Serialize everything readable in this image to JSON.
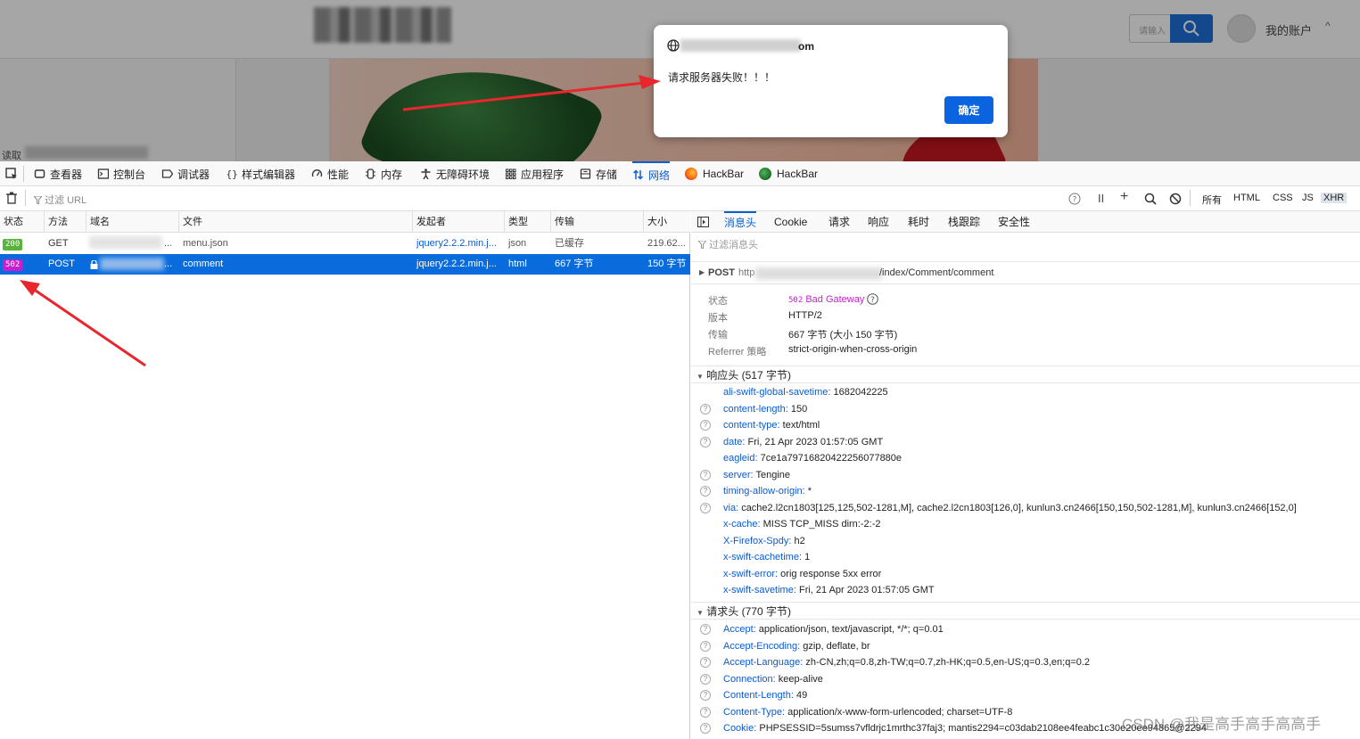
{
  "website": {
    "search_placeholder": "请输入",
    "account_label": "我的账户",
    "account_caret": "^",
    "reading_label": "读取"
  },
  "dialog": {
    "origin_suffix": "om",
    "message": "请求服务器失败！！！",
    "ok_label": "确定"
  },
  "devtools_tabs": [
    {
      "label": "查看器",
      "icon": "inspector-icon"
    },
    {
      "label": "控制台",
      "icon": "console-icon"
    },
    {
      "label": "调试器",
      "icon": "debugger-icon"
    },
    {
      "label": "样式编辑器",
      "icon": "style-editor-icon"
    },
    {
      "label": "性能",
      "icon": "performance-icon"
    },
    {
      "label": "内存",
      "icon": "memory-icon"
    },
    {
      "label": "无障碍环境",
      "icon": "accessibility-icon"
    },
    {
      "label": "应用程序",
      "icon": "application-icon"
    },
    {
      "label": "存储",
      "icon": "storage-icon"
    },
    {
      "label": "网络",
      "icon": "network-icon",
      "active": true
    },
    {
      "label": "HackBar",
      "icon": "firefox-icon"
    },
    {
      "label": "HackBar",
      "icon": "hackbar-green-icon"
    }
  ],
  "network_toolbar": {
    "filter_placeholder": "过滤 URL",
    "pause": "II",
    "add": "+",
    "filter_types": [
      "所有",
      "HTML",
      "CSS",
      "JS",
      "XHR"
    ],
    "selected_type": "XHR"
  },
  "request_columns": [
    "状态",
    "方法",
    "域名",
    "文件",
    "发起者",
    "类型",
    "传输",
    "大小"
  ],
  "requests": [
    {
      "status": "200",
      "status_color": "#58b43c",
      "method": "GET",
      "domain_suffix": "...",
      "file": "menu.json",
      "initiator": "jquery2.2.2.min.j...",
      "type": "json",
      "transfer": "已缓存",
      "size": "219.62..."
    },
    {
      "status": "502",
      "status_color": "#c71ed1",
      "method": "POST",
      "domain_suffix": "...",
      "file": "comment",
      "initiator": "jquery2.2.2.min.j...",
      "type": "html",
      "transfer": "667 字节",
      "size": "150 字节",
      "selected": true
    }
  ],
  "detail_tabs": [
    "消息头",
    "Cookie",
    "请求",
    "响应",
    "耗时",
    "栈跟踪",
    "安全性"
  ],
  "detail": {
    "filter_placeholder": "过滤消息头",
    "request_method": "POST",
    "request_url_prefix": "http",
    "request_url_suffix": "/index/Comment/comment",
    "summary": [
      {
        "k": "状态",
        "v": "502 Bad Gateway"
      },
      {
        "k": "版本",
        "v": "HTTP/2"
      },
      {
        "k": "传输",
        "v": "667 字节 (大小 150 字节)"
      },
      {
        "k": "Referrer 策略",
        "v": "strict-origin-when-cross-origin"
      }
    ],
    "status_code": "502",
    "status_text": "Bad Gateway",
    "response_section": "响应头 (517 字节)",
    "response_headers": [
      {
        "name": "ali-swift-global-savetime:",
        "value": "1682042225",
        "q": false
      },
      {
        "name": "content-length:",
        "value": "150",
        "q": true
      },
      {
        "name": "content-type:",
        "value": "text/html",
        "q": true
      },
      {
        "name": "date:",
        "value": "Fri, 21 Apr 2023 01:57:05 GMT",
        "q": true
      },
      {
        "name": "eagleid:",
        "value": "7ce1a79716820422256077880e",
        "q": false
      },
      {
        "name": "server:",
        "value": "Tengine",
        "q": true
      },
      {
        "name": "timing-allow-origin:",
        "value": "*",
        "q": true
      },
      {
        "name": "via:",
        "value": "cache2.l2cn1803[125,125,502-1281,M], cache2.l2cn1803[126,0], kunlun3.cn2466[150,150,502-1281,M], kunlun3.cn2466[152,0]",
        "q": true
      },
      {
        "name": "x-cache:",
        "value": "MISS TCP_MISS dirn:-2:-2",
        "q": false
      },
      {
        "name": "X-Firefox-Spdy:",
        "value": "h2",
        "q": false
      },
      {
        "name": "x-swift-cachetime:",
        "value": "1",
        "q": false
      },
      {
        "name": "x-swift-error:",
        "value": "orig response 5xx error",
        "q": false
      },
      {
        "name": "x-swift-savetime:",
        "value": "Fri, 21 Apr 2023 01:57:05 GMT",
        "q": false
      }
    ],
    "request_section": "请求头 (770 字节)",
    "request_headers": [
      {
        "name": "Accept:",
        "value": "application/json, text/javascript, */*; q=0.01",
        "q": true
      },
      {
        "name": "Accept-Encoding:",
        "value": "gzip, deflate, br",
        "q": true
      },
      {
        "name": "Accept-Language:",
        "value": "zh-CN,zh;q=0.8,zh-TW;q=0.7,zh-HK;q=0.5,en-US;q=0.3,en;q=0.2",
        "q": true
      },
      {
        "name": "Connection:",
        "value": "keep-alive",
        "q": true
      },
      {
        "name": "Content-Length:",
        "value": "49",
        "q": true
      },
      {
        "name": "Content-Type:",
        "value": "application/x-www-form-urlencoded; charset=UTF-8",
        "q": true
      },
      {
        "name": "Cookie:",
        "value": "PHPSESSID=5sumss7vfldrjc1mrthc37faj3; mantis2294=c03dab2108ee4feabc1c30e20ee94865@2294",
        "q": true
      }
    ]
  },
  "watermark": "CSDN @我是高手高手高高手",
  "colors": {
    "accent": "#0a60d0",
    "selected_row": "#0a6cdc",
    "header_name": "#0a5bd0",
    "error_status": "#c71ed1",
    "ok_status": "#58b43c",
    "arrow": "#e8262d"
  }
}
